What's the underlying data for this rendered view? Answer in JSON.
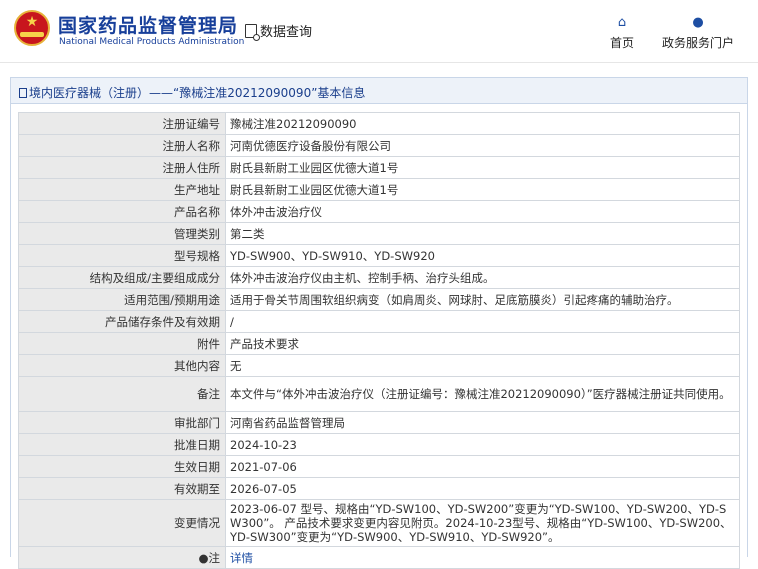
{
  "header": {
    "brand_cn": "国家药品监督管理局",
    "brand_en": "National Medical Products Administration",
    "query_label": "数据查询",
    "nav": [
      {
        "label": "首页",
        "icon": "home-icon"
      },
      {
        "label": "政务服务门户",
        "icon": "user-icon"
      }
    ]
  },
  "colors": {
    "brand": "#173f9a",
    "logo_red": "#c8161d",
    "link": "#1d4ea3"
  },
  "panel": {
    "title": "境内医疗器械（注册）——“豫械注准20212090090”基本信息"
  },
  "rows": [
    {
      "key": "注册证编号",
      "value": "豫械注准20212090090"
    },
    {
      "key": "注册人名称",
      "value": "河南优德医疗设备股份有限公司"
    },
    {
      "key": "注册人住所",
      "value": "尉氏县新尉工业园区优德大道1号"
    },
    {
      "key": "生产地址",
      "value": "尉氏县新尉工业园区优德大道1号"
    },
    {
      "key": "产品名称",
      "value": "体外冲击波治疗仪"
    },
    {
      "key": "管理类别",
      "value": "第二类"
    },
    {
      "key": "型号规格",
      "value": "YD-SW900、YD-SW910、YD-SW920"
    },
    {
      "key": "结构及组成/主要组成成分",
      "value": "体外冲击波治疗仪由主机、控制手柄、治疗头组成。"
    },
    {
      "key": "适用范围/预期用途",
      "value": "适用于骨关节周围软组织病变（如肩周炎、网球肘、足底筋膜炎）引起疼痛的辅助治疗。"
    },
    {
      "key": "产品储存条件及有效期",
      "value": "/"
    },
    {
      "key": "附件",
      "value": "产品技术要求"
    },
    {
      "key": "其他内容",
      "value": "无"
    },
    {
      "key": "备注",
      "value": "本文件与“体外冲击波治疗仪（注册证编号：豫械注准20212090090）”医疗器械注册证共同使用。"
    },
    {
      "key": "审批部门",
      "value": "河南省药品监督管理局"
    },
    {
      "key": "批准日期",
      "value": "2024-10-23"
    },
    {
      "key": "生效日期",
      "value": "2021-07-06"
    },
    {
      "key": "有效期至",
      "value": "2026-07-05"
    },
    {
      "key": "变更情况",
      "value": "2023-06-07 型号、规格由“YD-SW100、YD-SW200”变更为“YD-SW100、YD-SW200、YD-SW300”。 产品技术要求变更内容见附页。2024-10-23型号、规格由“YD-SW100、YD-SW200、YD-SW300”变更为“YD-SW900、YD-SW910、YD-SW920”。"
    },
    {
      "key": "注",
      "value": "详情",
      "icon": "lightbulb-icon"
    }
  ]
}
